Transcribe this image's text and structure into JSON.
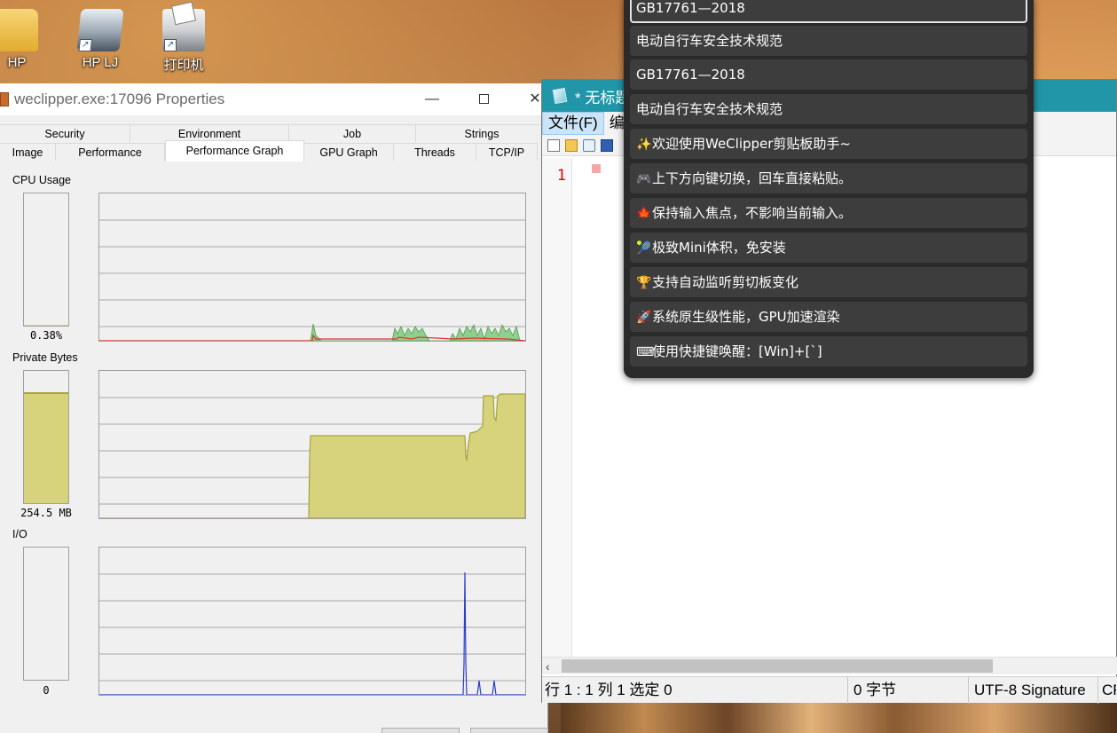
{
  "desktop": {
    "icons": [
      {
        "label": "HP",
        "icon": "folder-icon"
      },
      {
        "label": "HP LJ",
        "icon": "scanner-icon"
      },
      {
        "label": "打印机",
        "icon": "printer-icon"
      }
    ]
  },
  "properties_window": {
    "title": "weclipper.exe:17096 Properties",
    "tabs_row1": [
      "Security",
      "Environment",
      "Job",
      "Strings"
    ],
    "tabs_row2": [
      "Image",
      "Performance",
      "Performance Graph",
      "GPU Graph",
      "Threads",
      "TCP/IP"
    ],
    "active_tab": "Performance Graph",
    "sections": {
      "cpu": {
        "label": "CPU Usage",
        "value": "0.38%",
        "meter_fraction": 0.004
      },
      "private_bytes": {
        "label": "Private Bytes",
        "value": "254.5 MB",
        "meter_fraction": 0.84
      },
      "io": {
        "label": "I/O",
        "value": "0",
        "meter_fraction": 0
      }
    },
    "graph_colors": {
      "cpu_fill": "#8fcf8f",
      "cpu_kernel": "#e03030",
      "memory_fill": "#d6d37c",
      "memory_line": "#a8a33a",
      "io_line": "#2a3ec8"
    }
  },
  "notepad": {
    "title": "* 无标题",
    "menu": [
      "文件(F)",
      "编"
    ],
    "line_number": "1",
    "status": {
      "position": "行 1 : 1   列 1   选定 0",
      "bytes": "0 字节",
      "encoding": "UTF-8 Signature",
      "eol": "CR"
    }
  },
  "clipper": {
    "accent": "#e3e3e3",
    "items": [
      {
        "emoji": "",
        "text": "GB17761—2018"
      },
      {
        "emoji": "",
        "text": "电动自行车安全技术规范"
      },
      {
        "emoji": "",
        "text": "GB17761—2018"
      },
      {
        "emoji": "",
        "text": "电动自行车安全技术规范"
      },
      {
        "emoji": "✨",
        "text": "欢迎使用WeClipper剪贴板助手~"
      },
      {
        "emoji": "🎮",
        "text": "上下方向键切换，回车直接粘贴。"
      },
      {
        "emoji": "🍁",
        "text": "保持输入焦点，不影响当前输入。"
      },
      {
        "emoji": "🎾",
        "text": "极致Mini体积，免安装"
      },
      {
        "emoji": "🏆",
        "text": "支持自动监听剪切板变化"
      },
      {
        "emoji": "🚀",
        "text": "系统原生级性能，GPU加速渲染"
      },
      {
        "emoji": "⌨",
        "text": "使用快捷键唤醒：[Win]+[`]"
      }
    ]
  }
}
